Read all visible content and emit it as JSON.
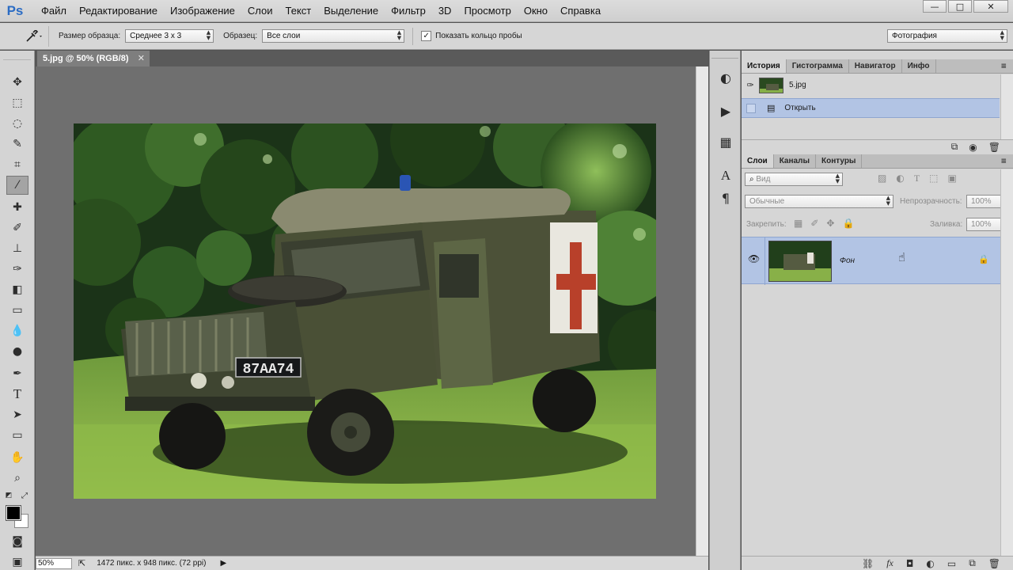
{
  "app": {
    "logo": "Ps"
  },
  "menu": [
    "Файл",
    "Редактирование",
    "Изображение",
    "Слои",
    "Текст",
    "Выделение",
    "Фильтр",
    "3D",
    "Просмотр",
    "Окно",
    "Справка"
  ],
  "window_buttons": {
    "minimize": "—",
    "maximize": "□",
    "close": "✕"
  },
  "options": {
    "sample_size_label": "Размер образца:",
    "sample_size_value": "Среднее 3 x 3",
    "sample_label": "Образец:",
    "sample_value": "Все слои",
    "show_ring_label": "Показать кольцо пробы",
    "show_ring_checked": true,
    "workspace_value": "Фотография"
  },
  "document": {
    "tab_title": "5.jpg @ 50% (RGB/8)",
    "zoom": "50%",
    "info": "1472 пикс. x 948 пикс. (72 ppi)",
    "plate": "87AA74"
  },
  "history_panel": {
    "tabs": [
      "История",
      "Гистограмма",
      "Навигатор",
      "Инфо"
    ],
    "active_tab": "История",
    "snapshot_name": "5.jpg",
    "steps": [
      {
        "label": "Открыть",
        "selected": true
      }
    ]
  },
  "layers_panel": {
    "tabs": [
      "Слои",
      "Каналы",
      "Контуры"
    ],
    "active_tab": "Слои",
    "filter_placeholder": "Вид",
    "blend_mode": "Обычные",
    "opacity_label": "Непрозрачность:",
    "opacity_value": "100%",
    "lock_label": "Закрепить:",
    "fill_label": "Заливка:",
    "fill_value": "100%",
    "layers": [
      {
        "name": "Фон",
        "visible": true,
        "locked": true,
        "selected": true
      }
    ]
  },
  "colors": {
    "selection": "#b2c4e4",
    "foreground": "#000000",
    "background": "#ffffff",
    "ps_blue": "#2b6cc4"
  }
}
